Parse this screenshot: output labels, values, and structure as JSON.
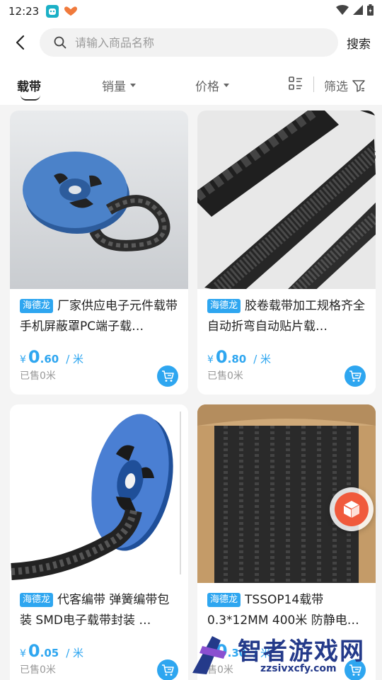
{
  "status": {
    "time": "12:23"
  },
  "header": {
    "search_placeholder": "请输入商品名称",
    "search_label": "搜索"
  },
  "tabs": [
    {
      "label": "载带",
      "active": true
    },
    {
      "label": "销量"
    },
    {
      "label": "价格"
    },
    {
      "label": "筛选"
    }
  ],
  "products": [
    {
      "brand": "海德龙",
      "title": "厂家供应电子元件载带手机屏蔽罩PC端子载…",
      "currency": "¥",
      "price_int": "0",
      "price_dec": ".60",
      "unit": "/ 米",
      "sold": "已售0米"
    },
    {
      "brand": "海德龙",
      "title": "胶卷载带加工规格齐全自动折弯自动贴片载…",
      "currency": "¥",
      "price_int": "0",
      "price_dec": ".80",
      "unit": "/ 米",
      "sold": "已售0米"
    },
    {
      "brand": "海德龙",
      "title": "代客编带 弹簧编带包装 SMD电子载带封装 …",
      "currency": "¥",
      "price_int": "0",
      "price_dec": ".05",
      "unit": "/ 米",
      "sold": "已售0米"
    },
    {
      "brand": "海德龙",
      "title": "TSSOP14载带0.3*12MM 400米 防静电载带 …",
      "currency": "¥",
      "price_int": "0",
      "price_dec": ".30",
      "unit": "/ 米",
      "sold": "售0米"
    }
  ],
  "watermark": {
    "text": "智者游戏网",
    "url": "zzsivxcfy.com"
  },
  "colors": {
    "accent": "#2ea6f0",
    "float_button": "#f05a3c"
  }
}
